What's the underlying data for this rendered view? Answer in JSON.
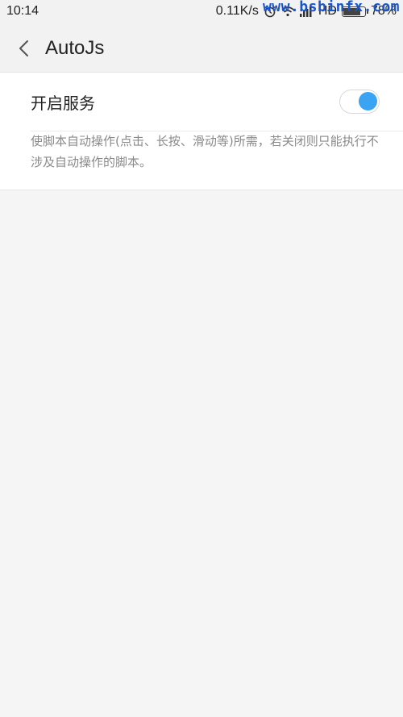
{
  "status_bar": {
    "time": "10:14",
    "speed": "0.11K/s",
    "network": "HD",
    "battery": "78%",
    "watermark": "www.bsbinfx.com",
    "icons": [
      "alarm-icon",
      "wifi-icon",
      "signal-icon",
      "battery-icon"
    ]
  },
  "toolbar": {
    "title": "AutoJs",
    "back_icon": "chevron-left-icon"
  },
  "setting": {
    "title": "开启服务",
    "toggle_on": true,
    "description": "使脚本自动操作(点击、长按、滑动等)所需，若关闭则只能执行不涉及自动操作的脚本。"
  },
  "colors": {
    "accent": "#3aa4f2",
    "background": "#f5f5f5",
    "card": "#ffffff"
  }
}
